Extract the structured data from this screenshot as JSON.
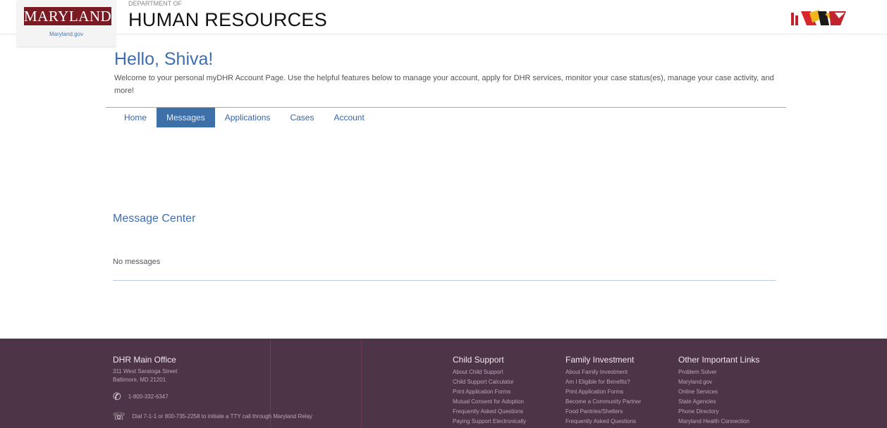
{
  "header": {
    "state_name": "MARYLAND",
    "state_site": "Maryland.gov",
    "dept_prefix": "DEPARTMENT OF",
    "dept_title": "HUMAN RESOURCES",
    "logo_text": "DHR"
  },
  "greeting": {
    "hello": "Hello, Shiva!",
    "welcome": "Welcome to your personal myDHR Account Page. Use the helpful features below to manage your account, apply for DHR services, monitor your case status(es), manage your case activity, and more!"
  },
  "nav": {
    "tabs": [
      {
        "label": "Home",
        "active": false
      },
      {
        "label": "Messages",
        "active": true
      },
      {
        "label": "Applications",
        "active": false
      },
      {
        "label": "Cases",
        "active": false
      },
      {
        "label": "Account",
        "active": false
      }
    ]
  },
  "message_center": {
    "title": "Message Center",
    "empty_text": "No messages"
  },
  "footer": {
    "main_office": {
      "heading": "DHR Main Office",
      "address1": "311 West Saratoga Street",
      "address2": "Baltimore, MD 21201",
      "phone": "1-800-332-6347",
      "tty": "Dial 7-1-1 or 800-735-2258 to initiate a TTY call through Maryland Relay"
    },
    "child_support": {
      "heading": "Child Support",
      "links": [
        "About Child Support",
        "Child Support Calculator",
        "Print Application Forms",
        "Mutual Consent for Adoption",
        "Frequently Asked Questions",
        "Paying Support Electronically"
      ]
    },
    "family_investment": {
      "heading": "Family Investment",
      "links": [
        "About Family Investment",
        "Am I Eligible for Benefits?",
        "Print Application Forms",
        "Become a Community Partner",
        "Food Pantries/Shelters",
        "Frequently Asked Questions"
      ]
    },
    "other_links": {
      "heading": "Other Important Links",
      "links": [
        "Problem Solver",
        "Maryland.gov",
        "Online Services",
        "State Agencies",
        "Phone Directory",
        "Maryland Health Connection"
      ]
    }
  },
  "colors": {
    "accent": "#3f6eb0",
    "active_tab": "#3d6fa9",
    "footer_bg": "#4e3447",
    "maryland_red": "#7a1a22"
  }
}
